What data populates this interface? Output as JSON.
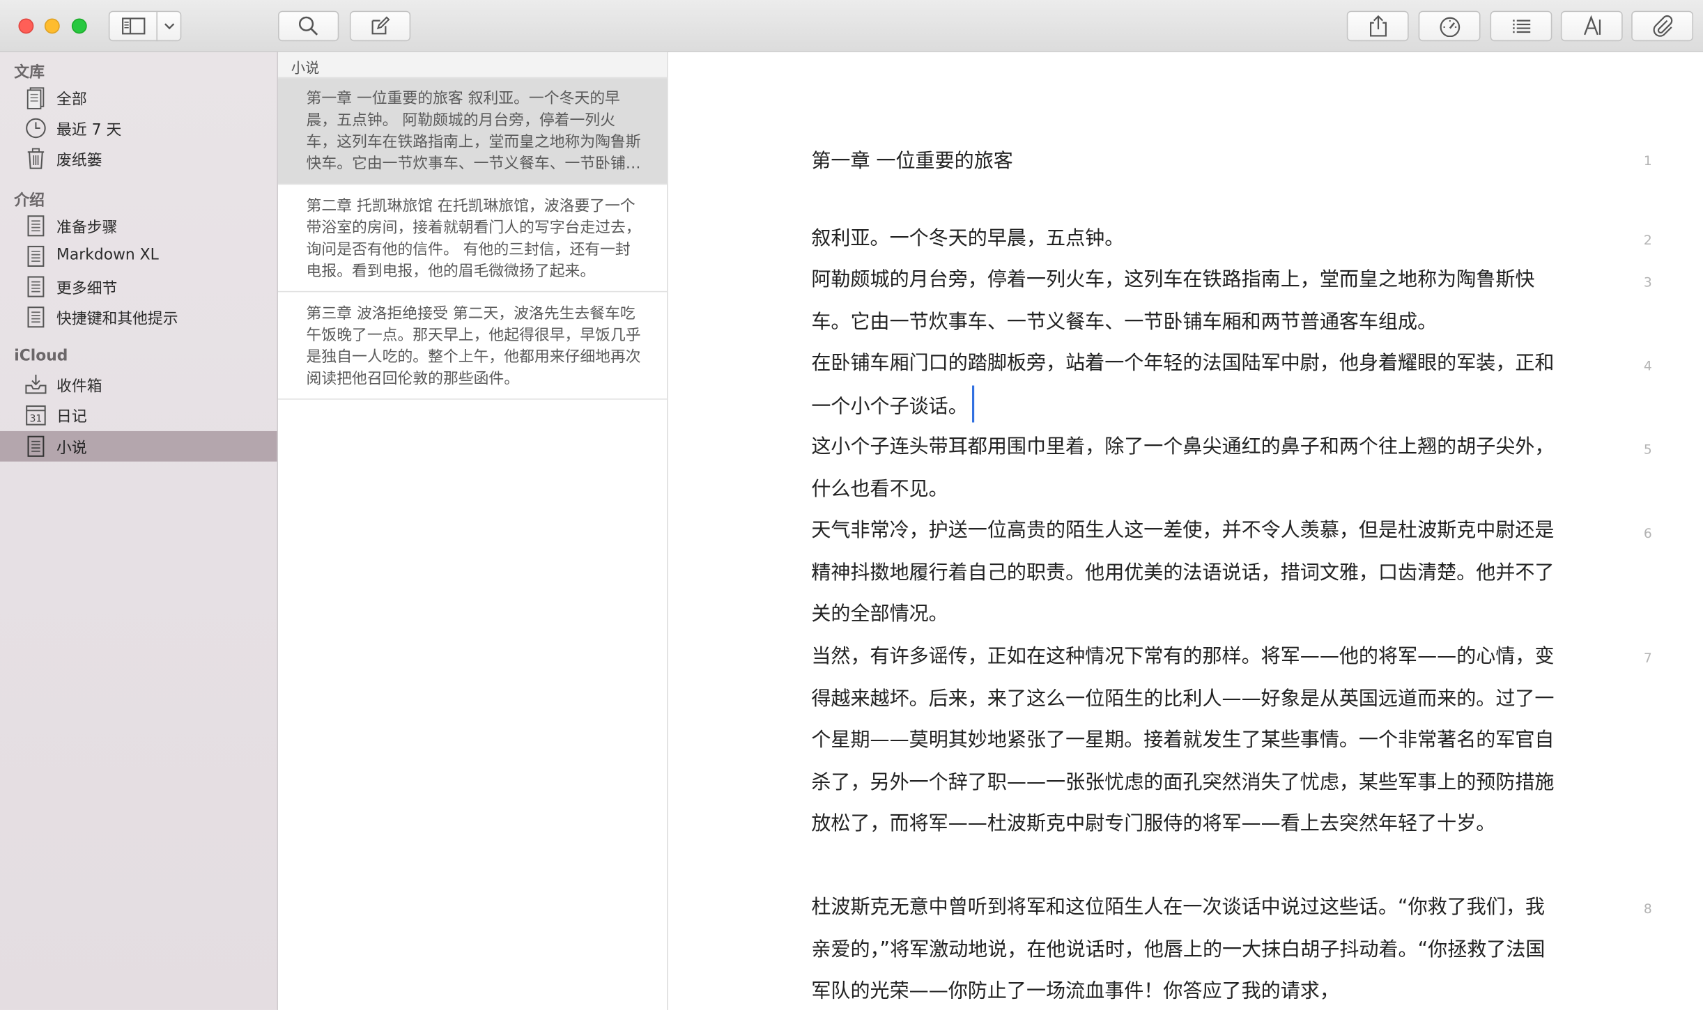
{
  "sidebar": {
    "sections": [
      {
        "header": "文库",
        "items": [
          {
            "label": "全部"
          },
          {
            "label": "最近 7 天"
          },
          {
            "label": "废纸篓"
          }
        ]
      },
      {
        "header": "介绍",
        "items": [
          {
            "label": "准备步骤"
          },
          {
            "label": "Markdown XL"
          },
          {
            "label": "更多细节"
          },
          {
            "label": "快捷键和其他提示"
          }
        ]
      },
      {
        "header": "iCloud",
        "items": [
          {
            "label": "收件箱"
          },
          {
            "label": "日记"
          },
          {
            "label": "小说"
          }
        ]
      }
    ],
    "calendar_icon_text": "31",
    "selected_item": "小说"
  },
  "note_list": {
    "header": "小说",
    "notes": [
      {
        "text": "第一章 一位重要的旅客 叙利亚。一个冬天的早晨，五点钟。 阿勒颇城的月台旁，停着一列火车，这列车在铁路指南上，堂而皇之地称为陶鲁斯快车。它由一节炊事车、一节义餐车、一节卧铺车厢和两节普通客车组成。"
      },
      {
        "text": "第二章 托凯琳旅馆 在托凯琳旅馆，波洛要了一个带浴室的房间，接着就朝看门人的写字台走过去，询问是否有他的信件。 有他的三封信，还有一封电报。看到电报，他的眉毛微微扬了起来。"
      },
      {
        "text": "第三章 波洛拒绝接受 第二天，波洛先生去餐车吃午饭晚了一点。那天早上，他起得很早，早饭几乎是独自一人吃的。整个上午，他都用来仔细地再次阅读把他召回伦敦的那些函件。"
      }
    ]
  },
  "editor": {
    "title": "第一章 一位重要的旅客",
    "title_line": "1",
    "paragraphs": [
      {
        "line": "2",
        "text": "叙利亚。一个冬天的早晨，五点钟。"
      },
      {
        "line": "3",
        "text": "阿勒颇城的月台旁，停着一列火车，这列车在铁路指南上，堂而皇之地称为陶鲁斯快车。它由一节炊事车、一节义餐车、一节卧铺车厢和两节普通客车组成。"
      },
      {
        "line": "4",
        "text": "在卧铺车厢门口的踏脚板旁，站着一个年轻的法国陆军中尉，他身着耀眼的军装，正和一个小个子谈话。"
      },
      {
        "line": "5",
        "text": "这小个子连头带耳都用围巾里着，除了一个鼻尖通红的鼻子和两个往上翘的胡子尖外，什么也看不见。"
      },
      {
        "line": "6",
        "text": "天气非常冷，护送一位高贵的陌生人这一差使，并不令人羡慕，但是杜波斯克中尉还是精神抖擞地履行着自己的职责。他用优美的法语说话，措词文雅，口齿清楚。他并不了关的全部情况。"
      },
      {
        "line": "7",
        "text": "当然，有许多谣传，正如在这种情况下常有的那样。将军——他的将军——的心情，变得越来越坏。后来，来了这么一位陌生的比利人——好象是从英国远道而来的。过了一个星期——莫明其妙地紧张了一星期。接着就发生了某些事情。一个非常著名的军官自杀了，另外一个辞了职——一张张忧虑的面孔突然消失了忧虑，某些军事上的预防措施放松了，而将军——杜波斯克中尉专门服侍的将军——看上去突然年轻了十岁。"
      },
      {
        "line": "8",
        "text": "杜波斯克无意中曾听到将军和这位陌生人在一次谈话中说过这些话。“你救了我们，我亲爱的，”将军激动地说，在他说话时，他唇上的一大抹白胡子抖动着。“你拯救了法国军队的光荣——你防止了一场流血事件！你答应了我的请求，"
      }
    ]
  }
}
